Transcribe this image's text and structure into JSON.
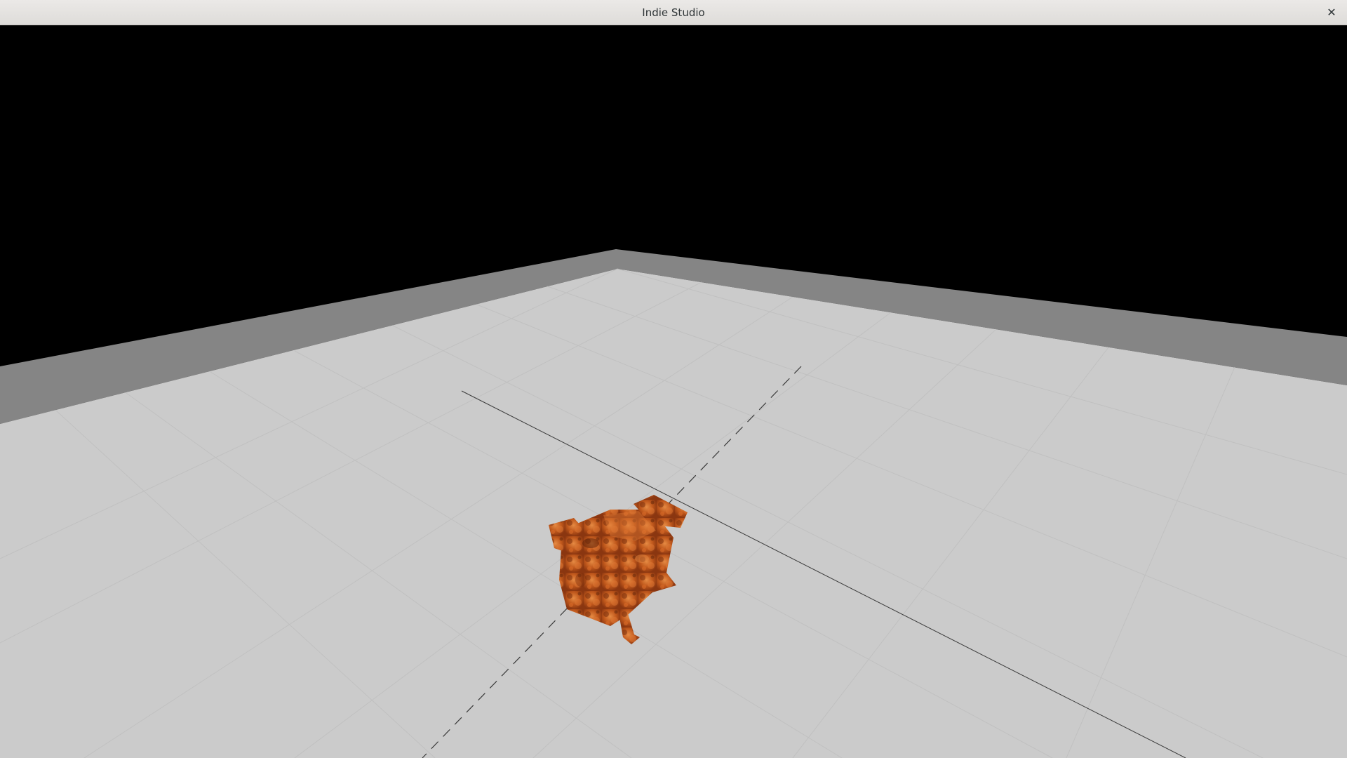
{
  "window": {
    "title": "Indie Studio",
    "close_glyph": "✕",
    "close_icon": "close-icon"
  },
  "scene": {
    "background_color": "#000000",
    "floor_color": "#cbcbcb",
    "wall_color": "#858585",
    "grid_color": "#bdbdbd",
    "axis_color": "#3a3a3a",
    "character": {
      "name": "textured-creature-model",
      "base_color": "#c0581c",
      "dark_color": "#6e2a0c",
      "light_color": "#e07a35"
    }
  }
}
